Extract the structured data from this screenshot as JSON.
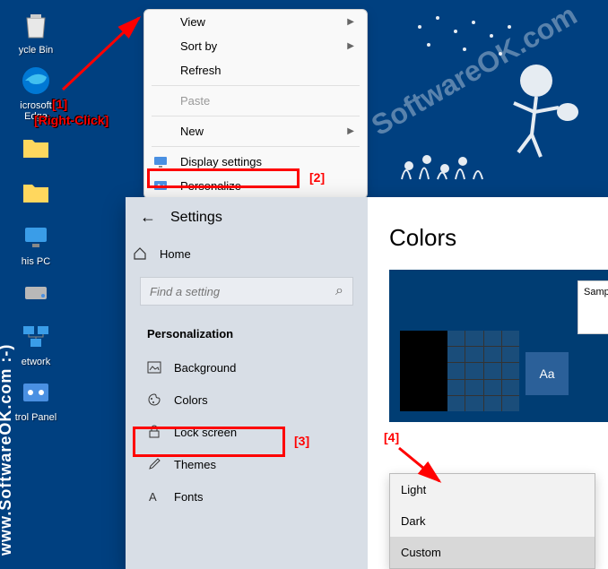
{
  "desktop": {
    "icons": [
      {
        "label": "ycle Bin",
        "type": "recycle"
      },
      {
        "label": "icrosoft\nEdge",
        "type": "edge"
      },
      {
        "label": "",
        "type": "folder"
      },
      {
        "label": "",
        "type": "folder"
      },
      {
        "label": "his PC",
        "type": "pc"
      },
      {
        "label": "",
        "type": "disk"
      },
      {
        "label": "etwork",
        "type": "network"
      },
      {
        "label": "trol Panel",
        "type": "control"
      }
    ]
  },
  "context_menu": {
    "items": [
      {
        "label": "View",
        "submenu": true
      },
      {
        "label": "Sort by",
        "submenu": true
      },
      {
        "label": "Refresh"
      },
      {
        "divider": true
      },
      {
        "label": "Paste",
        "disabled": true
      },
      {
        "divider": true
      },
      {
        "label": "New",
        "submenu": true
      },
      {
        "divider": true
      },
      {
        "label": "Display settings",
        "icon": "display"
      },
      {
        "label": "Personalize",
        "icon": "personalize"
      }
    ]
  },
  "annotations": {
    "a1": "[1]",
    "a1_label": "[Right-Click]",
    "a2": "[2]",
    "a3": "[3]",
    "a4": "[4]"
  },
  "settings": {
    "back": "←",
    "title": "Settings",
    "home_label": "Home",
    "search_placeholder": "Find a setting",
    "category": "Personalization",
    "nav": [
      {
        "label": "Background",
        "icon": "image"
      },
      {
        "label": "Colors",
        "icon": "palette"
      },
      {
        "label": "Lock screen",
        "icon": "lock"
      },
      {
        "label": "Themes",
        "icon": "brush"
      },
      {
        "label": "Fonts",
        "icon": "font"
      }
    ],
    "main_title": "Colors",
    "preview_accent_text": "Aa",
    "preview_sample_text": "Sample",
    "dropdown": [
      "Light",
      "Dark",
      "Custom"
    ],
    "dropdown_selected": 2
  },
  "watermark": "www.SoftwareOK.com :-)",
  "watermark_diag": "SoftwareOK.com"
}
